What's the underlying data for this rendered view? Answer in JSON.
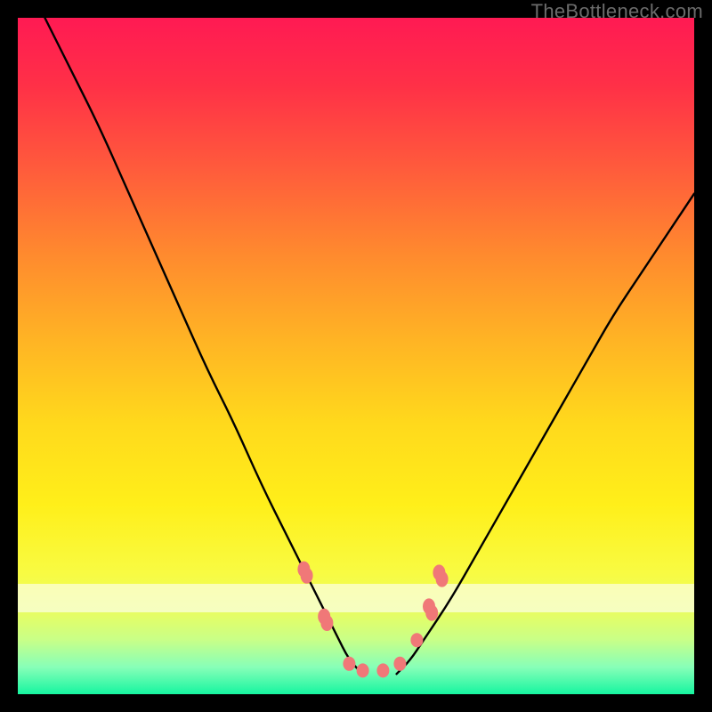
{
  "watermark": "TheBottleneck.com",
  "chart_data": {
    "type": "line",
    "title": "",
    "xlabel": "",
    "ylabel": "",
    "xlim": [
      0,
      100
    ],
    "ylim": [
      0,
      100
    ],
    "grid": false,
    "legend": false,
    "series": [
      {
        "name": "left-curve",
        "x": [
          4,
          8,
          12,
          16,
          20,
          24,
          28,
          32,
          36,
          40,
          44,
          47,
          49,
          51
        ],
        "y": [
          100,
          92,
          84,
          75,
          66,
          57,
          48,
          40,
          31,
          23,
          15,
          9,
          5,
          3
        ]
      },
      {
        "name": "right-curve",
        "x": [
          56,
          58,
          60,
          64,
          68,
          72,
          76,
          80,
          84,
          88,
          92,
          96,
          100
        ],
        "y": [
          3,
          5,
          8,
          14,
          21,
          28,
          35,
          42,
          49,
          56,
          62,
          68,
          74
        ]
      }
    ],
    "markers": [
      {
        "x": 42.5,
        "y": 18,
        "shape": "pair"
      },
      {
        "x": 45.5,
        "y": 11,
        "shape": "pair"
      },
      {
        "x": 49.0,
        "y": 4.5,
        "shape": "dot"
      },
      {
        "x": 51.0,
        "y": 3.5,
        "shape": "dot"
      },
      {
        "x": 54.0,
        "y": 3.5,
        "shape": "dot"
      },
      {
        "x": 56.5,
        "y": 4.5,
        "shape": "dot"
      },
      {
        "x": 59.0,
        "y": 8,
        "shape": "dot"
      },
      {
        "x": 61.0,
        "y": 12.5,
        "shape": "pair"
      },
      {
        "x": 62.5,
        "y": 17.5,
        "shape": "pair"
      }
    ],
    "marker_color": "#f07878",
    "curve_color": "#000000"
  }
}
